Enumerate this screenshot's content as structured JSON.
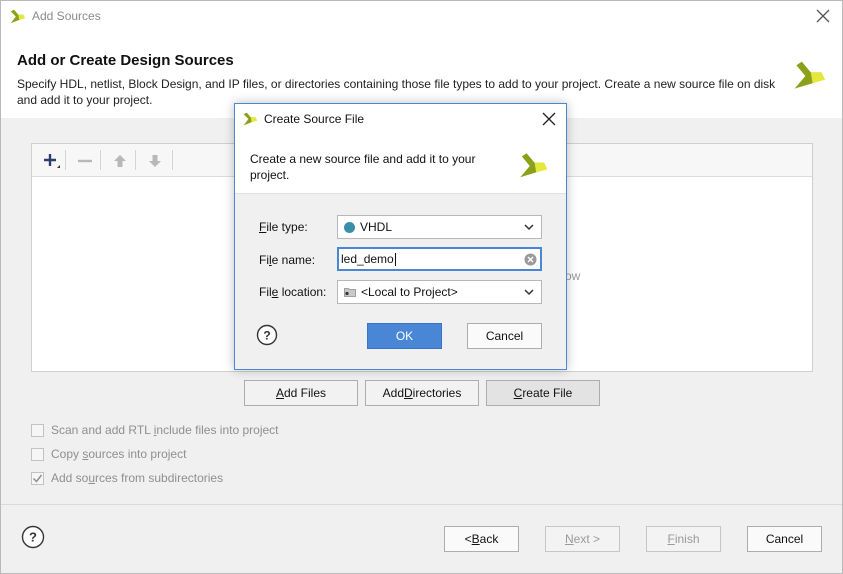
{
  "window": {
    "title": "Add Sources"
  },
  "header": {
    "title": "Add or Create Design Sources",
    "description": "Specify HDL, netlist, Block Design, and IP files, or directories containing those file types to add to your project. Create a new source file on disk and add it to your project."
  },
  "panel": {
    "hint_fragment": "ow"
  },
  "buttons": {
    "add_files": {
      "pre": "",
      "key": "A",
      "post": "dd Files"
    },
    "add_directories": {
      "pre": "Add ",
      "key": "D",
      "post": "irectories"
    },
    "create_file": {
      "pre": "",
      "key": "C",
      "post": "reate File"
    }
  },
  "options": [
    {
      "pre": "Scan and add RTL ",
      "key": "i",
      "post": "nclude files into project",
      "checked": false
    },
    {
      "pre": "Copy ",
      "key": "s",
      "post": "ources into project",
      "checked": false
    },
    {
      "pre": "Add so",
      "key": "u",
      "post": "rces from subdirectories",
      "checked": true
    }
  ],
  "footer": {
    "back": {
      "pre": "< ",
      "key": "B",
      "post": "ack"
    },
    "next": {
      "pre": "",
      "key": "N",
      "post": "ext >"
    },
    "finish": {
      "pre": "",
      "key": "F",
      "post": "inish"
    },
    "cancel": "Cancel"
  },
  "dialog": {
    "title": "Create Source File",
    "description": "Create a new source file and add it to your project.",
    "file_type": {
      "label_pre": "",
      "label_key": "F",
      "label_post": "ile type:",
      "value": "VHDL"
    },
    "file_name": {
      "label_pre": "Fi",
      "label_key": "l",
      "label_post": "e name:",
      "value": "led_demo"
    },
    "file_location": {
      "label_pre": "Fil",
      "label_key": "e",
      "label_post": " location:",
      "value": "<Local to Project>"
    },
    "ok": "OK",
    "cancel": "Cancel"
  },
  "colors": {
    "accent": "#4a86d6",
    "logo_green": "#8ca11b",
    "logo_yellow": "#e4e83a",
    "vhdl_dot": "#3a8fa8"
  },
  "icons": [
    "vivado-logo-icon",
    "close-icon",
    "add-icon",
    "remove-icon",
    "move-up-icon",
    "move-down-icon",
    "help-icon",
    "chevron-down-icon",
    "clear-icon",
    "folder-icon"
  ]
}
